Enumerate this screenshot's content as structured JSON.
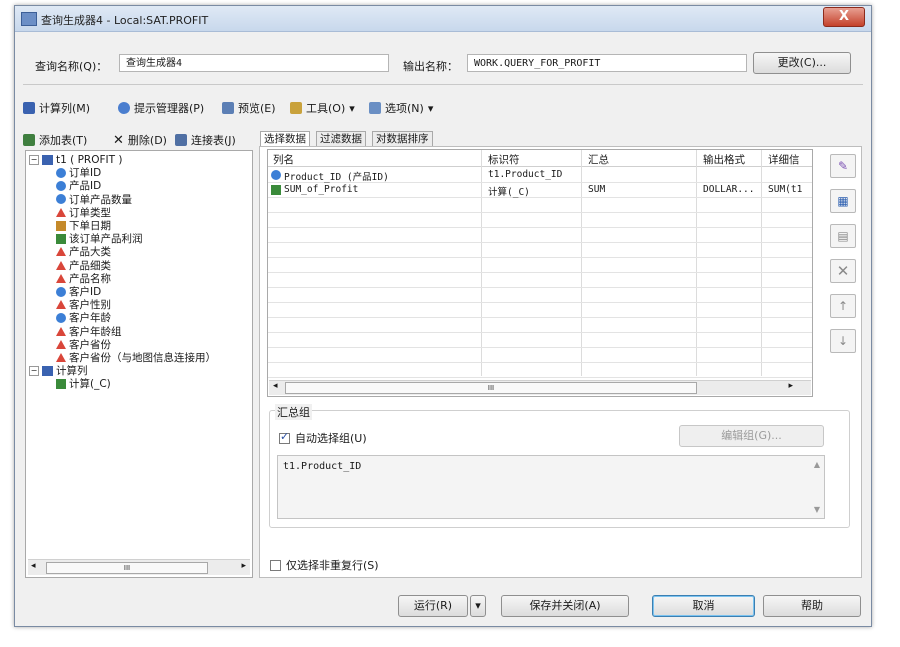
{
  "window": {
    "title": "查询生成器4 - Local:SAT.PROFIT",
    "close_label": "X"
  },
  "query": {
    "name_label": "查询名称(Q)：",
    "name_value": "查询生成器4",
    "output_label": "输出名称：",
    "output_value": "WORK.QUERY_FOR_PROFIT",
    "change_button": "更改(C)..."
  },
  "toolbar": {
    "computed_columns": "计算列(M)",
    "prompt_manager": "提示管理器(P)",
    "preview": "预览(E)",
    "tools": "工具(O)",
    "options": "选项(N)"
  },
  "left_toolbar": {
    "add_table": "添加表(T)",
    "delete": "删除(D)",
    "join_tables": "连接表(J)"
  },
  "tree": {
    "root": "t1 ( PROFIT )",
    "items": [
      {
        "label": "订单ID",
        "icon": "numeric-column-icon"
      },
      {
        "label": "产品ID",
        "icon": "numeric-column-icon"
      },
      {
        "label": "订单产品数量",
        "icon": "numeric-column-icon"
      },
      {
        "label": "订单类型",
        "icon": "character-column-icon"
      },
      {
        "label": "下单日期",
        "icon": "date-column-icon"
      },
      {
        "label": "该订单产品利润",
        "icon": "currency-column-icon"
      },
      {
        "label": "产品大类",
        "icon": "character-column-icon"
      },
      {
        "label": "产品细类",
        "icon": "character-column-icon"
      },
      {
        "label": "产品名称",
        "icon": "character-column-icon"
      },
      {
        "label": "客户ID",
        "icon": "numeric-column-icon"
      },
      {
        "label": "客户性别",
        "icon": "character-column-icon"
      },
      {
        "label": "客户年龄",
        "icon": "numeric-column-icon"
      },
      {
        "label": "客户年龄组",
        "icon": "character-column-icon"
      },
      {
        "label": "客户省份",
        "icon": "character-column-icon"
      },
      {
        "label": "客户省份（与地图信息连接用）",
        "icon": "character-column-icon"
      }
    ],
    "computed_root": "计算列",
    "computed_items": [
      {
        "label": "计算(_C)",
        "icon": "computed-column-icon"
      }
    ],
    "scroll_label": "III"
  },
  "tabs": [
    "选择数据",
    "过滤数据",
    "对数据排序"
  ],
  "grid": {
    "headers": [
      "列名",
      "标识符",
      "汇总",
      "输出格式",
      "详细信"
    ],
    "rows": [
      [
        "Product_ID (产品ID)",
        "t1.Product_ID",
        "",
        "",
        ""
      ],
      [
        "SUM_of_Profit",
        "计算(_C)",
        "SUM",
        "DOLLAR...",
        "SUM(t1"
      ]
    ],
    "scroll_label": "III"
  },
  "summary": {
    "group_label": "汇总组",
    "auto_select_label": "自动选择组(U)",
    "auto_select_checked": true,
    "edit_groups_button": "编辑组(G)...",
    "group_text": "t1.Product_ID"
  },
  "distinct": {
    "label": "仅选择非重复行(S)",
    "checked": false
  },
  "footer": {
    "run_button": "运行(R)",
    "save_close_button": "保存并关闭(A)",
    "cancel_button": "取消",
    "help_button": "帮助"
  }
}
